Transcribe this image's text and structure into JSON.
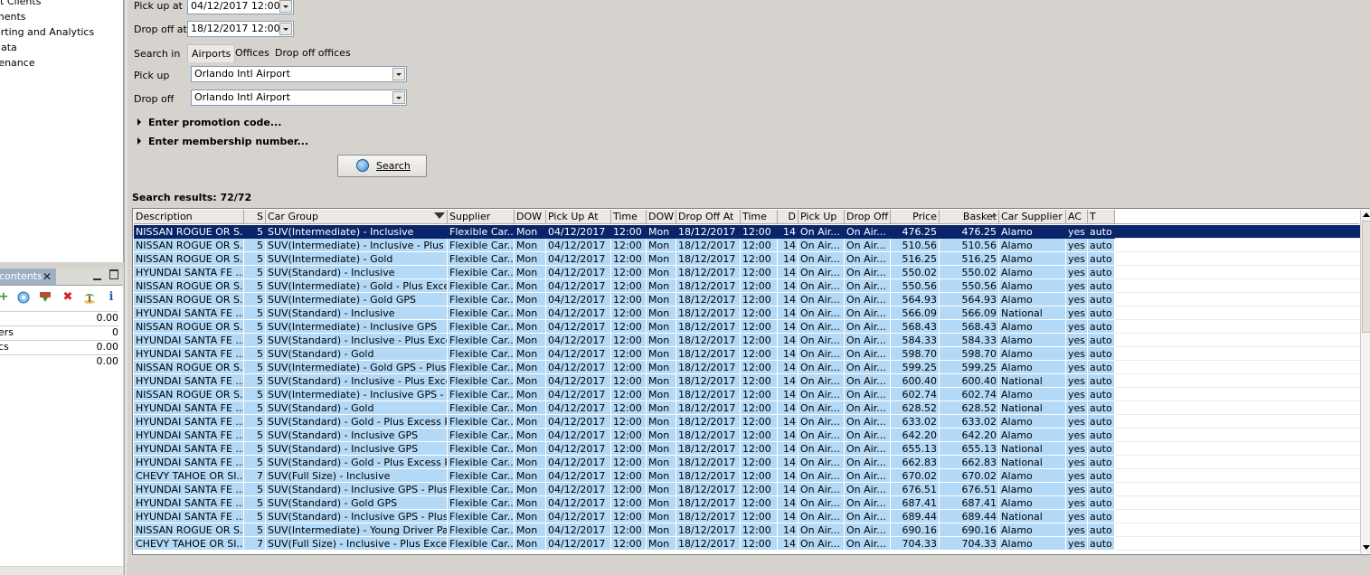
{
  "sidebar": {
    "items": [
      {
        "label": "ct Clients"
      },
      {
        "label": "ments"
      },
      {
        "label": "orting and Analytics"
      },
      {
        "label": "data"
      },
      {
        "label": "tenance"
      }
    ]
  },
  "contents_panel": {
    "tab_label": "contents",
    "close_glyph": "✕",
    "icons": [
      "add-icon",
      "refresh-icon",
      "download-icon",
      "delete-icon",
      "palm-tree-icon",
      "info-icon"
    ],
    "rows": [
      {
        "label": "",
        "value": "0.00"
      },
      {
        "label": "ers",
        "value": "0"
      },
      {
        "label": "cs",
        "value": "0.00"
      },
      {
        "label": "",
        "value": "0.00"
      }
    ]
  },
  "form": {
    "pickup_at_label": "Pick up at",
    "pickup_at_value": "04/12/2017 12:00",
    "dropoff_at_label": "Drop off at",
    "dropoff_at_value": "18/12/2017 12:00",
    "search_in_label": "Search in",
    "search_in_tabs": [
      "Airports",
      "Offices",
      "Drop off offices"
    ],
    "pickup_label": "Pick up",
    "pickup_value": "Orlando Intl Airport",
    "dropoff_label": "Drop off",
    "dropoff_value": "Orlando Intl Airport",
    "promo_label": "Enter promotion code...",
    "membership_label": "Enter membership number...",
    "search_button": "Search"
  },
  "results": {
    "label": "Search results: 72/72",
    "columns": [
      "Description",
      "S",
      "Car Group",
      "Supplier",
      "DOW",
      "Pick Up At",
      "Time",
      "DOW",
      "Drop Off At",
      "Time",
      "D",
      "Pick Up",
      "Drop Off",
      "Price",
      "Basket",
      "Car Supplier",
      "AC",
      "T"
    ],
    "rows": [
      [
        "NISSAN ROGUE OR S...",
        "5",
        "SUV(Intermediate) - Inclusive",
        "Flexible Car...",
        "Mon",
        "04/12/2017",
        "12:00",
        "Mon",
        "18/12/2017",
        "12:00",
        "14",
        "On Air...",
        "On Air...",
        "476.25",
        "476.25",
        "Alamo",
        "yes",
        "auto"
      ],
      [
        "NISSAN ROGUE OR S...",
        "5",
        "SUV(Intermediate) - Inclusive - Plus E...",
        "Flexible Car...",
        "Mon",
        "04/12/2017",
        "12:00",
        "Mon",
        "18/12/2017",
        "12:00",
        "14",
        "On Air...",
        "On Air...",
        "510.56",
        "510.56",
        "Alamo",
        "yes",
        "auto"
      ],
      [
        "NISSAN ROGUE OR S...",
        "5",
        "SUV(Intermediate) - Gold",
        "Flexible Car...",
        "Mon",
        "04/12/2017",
        "12:00",
        "Mon",
        "18/12/2017",
        "12:00",
        "14",
        "On Air...",
        "On Air...",
        "516.25",
        "516.25",
        "Alamo",
        "yes",
        "auto"
      ],
      [
        "HYUNDAI SANTA FE ...",
        "5",
        "SUV(Standard) - Inclusive",
        "Flexible Car...",
        "Mon",
        "04/12/2017",
        "12:00",
        "Mon",
        "18/12/2017",
        "12:00",
        "14",
        "On Air...",
        "On Air...",
        "550.02",
        "550.02",
        "Alamo",
        "yes",
        "auto"
      ],
      [
        "NISSAN ROGUE OR S...",
        "5",
        "SUV(Intermediate) - Gold - Plus Exces...",
        "Flexible Car...",
        "Mon",
        "04/12/2017",
        "12:00",
        "Mon",
        "18/12/2017",
        "12:00",
        "14",
        "On Air...",
        "On Air...",
        "550.56",
        "550.56",
        "Alamo",
        "yes",
        "auto"
      ],
      [
        "NISSAN ROGUE OR S...",
        "5",
        "SUV(Intermediate) - Gold GPS",
        "Flexible Car...",
        "Mon",
        "04/12/2017",
        "12:00",
        "Mon",
        "18/12/2017",
        "12:00",
        "14",
        "On Air...",
        "On Air...",
        "564.93",
        "564.93",
        "Alamo",
        "yes",
        "auto"
      ],
      [
        "HYUNDAI SANTA FE ...",
        "5",
        "SUV(Standard) - Inclusive",
        "Flexible Car...",
        "Mon",
        "04/12/2017",
        "12:00",
        "Mon",
        "18/12/2017",
        "12:00",
        "14",
        "On Air...",
        "On Air...",
        "566.09",
        "566.09",
        "National",
        "yes",
        "auto"
      ],
      [
        "NISSAN ROGUE OR S...",
        "5",
        "SUV(Intermediate) - Inclusive GPS",
        "Flexible Car...",
        "Mon",
        "04/12/2017",
        "12:00",
        "Mon",
        "18/12/2017",
        "12:00",
        "14",
        "On Air...",
        "On Air...",
        "568.43",
        "568.43",
        "Alamo",
        "yes",
        "auto"
      ],
      [
        "HYUNDAI SANTA FE ...",
        "5",
        "SUV(Standard) - Inclusive - Plus Exce...",
        "Flexible Car...",
        "Mon",
        "04/12/2017",
        "12:00",
        "Mon",
        "18/12/2017",
        "12:00",
        "14",
        "On Air...",
        "On Air...",
        "584.33",
        "584.33",
        "Alamo",
        "yes",
        "auto"
      ],
      [
        "HYUNDAI SANTA FE ...",
        "5",
        "SUV(Standard) - Gold",
        "Flexible Car...",
        "Mon",
        "04/12/2017",
        "12:00",
        "Mon",
        "18/12/2017",
        "12:00",
        "14",
        "On Air...",
        "On Air...",
        "598.70",
        "598.70",
        "Alamo",
        "yes",
        "auto"
      ],
      [
        "NISSAN ROGUE OR S...",
        "5",
        "SUV(Intermediate) - Gold GPS - Plus E...",
        "Flexible Car...",
        "Mon",
        "04/12/2017",
        "12:00",
        "Mon",
        "18/12/2017",
        "12:00",
        "14",
        "On Air...",
        "On Air...",
        "599.25",
        "599.25",
        "Alamo",
        "yes",
        "auto"
      ],
      [
        "HYUNDAI SANTA FE ...",
        "5",
        "SUV(Standard) - Inclusive - Plus Exce...",
        "Flexible Car...",
        "Mon",
        "04/12/2017",
        "12:00",
        "Mon",
        "18/12/2017",
        "12:00",
        "14",
        "On Air...",
        "On Air...",
        "600.40",
        "600.40",
        "National",
        "yes",
        "auto"
      ],
      [
        "NISSAN ROGUE OR S...",
        "5",
        "SUV(Intermediate) - Inclusive GPS - Pl...",
        "Flexible Car...",
        "Mon",
        "04/12/2017",
        "12:00",
        "Mon",
        "18/12/2017",
        "12:00",
        "14",
        "On Air...",
        "On Air...",
        "602.74",
        "602.74",
        "Alamo",
        "yes",
        "auto"
      ],
      [
        "HYUNDAI SANTA FE ...",
        "5",
        "SUV(Standard) - Gold",
        "Flexible Car...",
        "Mon",
        "04/12/2017",
        "12:00",
        "Mon",
        "18/12/2017",
        "12:00",
        "14",
        "On Air...",
        "On Air...",
        "628.52",
        "628.52",
        "National",
        "yes",
        "auto"
      ],
      [
        "HYUNDAI SANTA FE ...",
        "5",
        "SUV(Standard) - Gold - Plus Excess R...",
        "Flexible Car...",
        "Mon",
        "04/12/2017",
        "12:00",
        "Mon",
        "18/12/2017",
        "12:00",
        "14",
        "On Air...",
        "On Air...",
        "633.02",
        "633.02",
        "Alamo",
        "yes",
        "auto"
      ],
      [
        "HYUNDAI SANTA FE ...",
        "5",
        "SUV(Standard) - Inclusive GPS",
        "Flexible Car...",
        "Mon",
        "04/12/2017",
        "12:00",
        "Mon",
        "18/12/2017",
        "12:00",
        "14",
        "On Air...",
        "On Air...",
        "642.20",
        "642.20",
        "Alamo",
        "yes",
        "auto"
      ],
      [
        "HYUNDAI SANTA FE ...",
        "5",
        "SUV(Standard) - Inclusive GPS",
        "Flexible Car...",
        "Mon",
        "04/12/2017",
        "12:00",
        "Mon",
        "18/12/2017",
        "12:00",
        "14",
        "On Air...",
        "On Air...",
        "655.13",
        "655.13",
        "National",
        "yes",
        "auto"
      ],
      [
        "HYUNDAI SANTA FE ...",
        "5",
        "SUV(Standard) - Gold - Plus Excess R...",
        "Flexible Car...",
        "Mon",
        "04/12/2017",
        "12:00",
        "Mon",
        "18/12/2017",
        "12:00",
        "14",
        "On Air...",
        "On Air...",
        "662.83",
        "662.83",
        "National",
        "yes",
        "auto"
      ],
      [
        "CHEVY TAHOE OR SI...",
        "7",
        "SUV(Full Size) - Inclusive",
        "Flexible Car...",
        "Mon",
        "04/12/2017",
        "12:00",
        "Mon",
        "18/12/2017",
        "12:00",
        "14",
        "On Air...",
        "On Air...",
        "670.02",
        "670.02",
        "Alamo",
        "yes",
        "auto"
      ],
      [
        "HYUNDAI SANTA FE ...",
        "5",
        "SUV(Standard) - Inclusive GPS - Plus ...",
        "Flexible Car...",
        "Mon",
        "04/12/2017",
        "12:00",
        "Mon",
        "18/12/2017",
        "12:00",
        "14",
        "On Air...",
        "On Air...",
        "676.51",
        "676.51",
        "Alamo",
        "yes",
        "auto"
      ],
      [
        "HYUNDAI SANTA FE ...",
        "5",
        "SUV(Standard) - Gold GPS",
        "Flexible Car...",
        "Mon",
        "04/12/2017",
        "12:00",
        "Mon",
        "18/12/2017",
        "12:00",
        "14",
        "On Air...",
        "On Air...",
        "687.41",
        "687.41",
        "Alamo",
        "yes",
        "auto"
      ],
      [
        "HYUNDAI SANTA FE ...",
        "5",
        "SUV(Standard) - Inclusive GPS - Plus ...",
        "Flexible Car...",
        "Mon",
        "04/12/2017",
        "12:00",
        "Mon",
        "18/12/2017",
        "12:00",
        "14",
        "On Air...",
        "On Air...",
        "689.44",
        "689.44",
        "National",
        "yes",
        "auto"
      ],
      [
        "NISSAN ROGUE OR S...",
        "5",
        "SUV(Intermediate) - Young Driver Pac...",
        "Flexible Car...",
        "Mon",
        "04/12/2017",
        "12:00",
        "Mon",
        "18/12/2017",
        "12:00",
        "14",
        "On Air...",
        "On Air...",
        "690.16",
        "690.16",
        "Alamo",
        "yes",
        "auto"
      ],
      [
        "CHEVY TAHOE OR SI...",
        "7",
        "SUV(Full Size) - Inclusive - Plus Excess...",
        "Flexible Car...",
        "Mon",
        "04/12/2017",
        "12:00",
        "Mon",
        "18/12/2017",
        "12:00",
        "14",
        "On Air...",
        "On Air...",
        "704.33",
        "704.33",
        "Alamo",
        "yes",
        "auto"
      ]
    ]
  },
  "colors": {
    "row_bg": "#b3d9f7",
    "selected_bg": "#0a246a",
    "window_bg": "#d6d3ce"
  }
}
